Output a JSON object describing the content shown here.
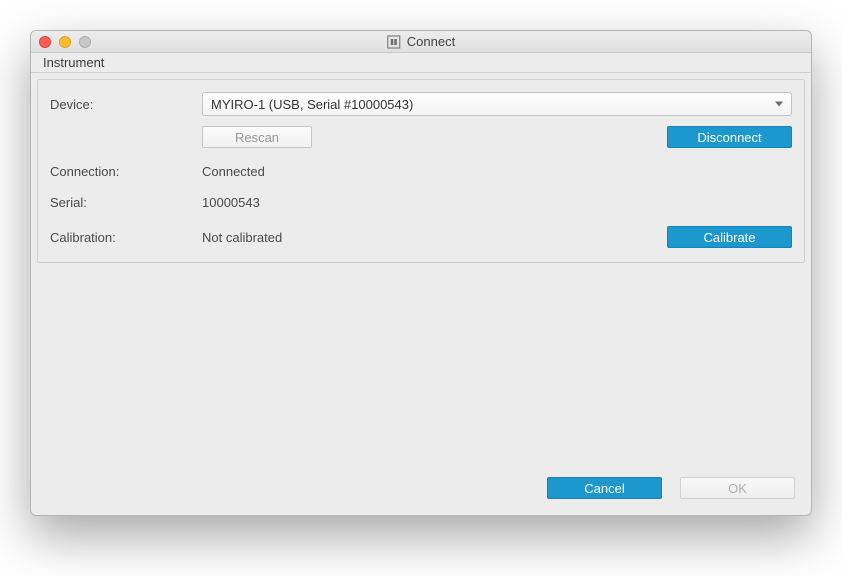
{
  "window": {
    "title": "Connect"
  },
  "menu": {
    "instrument": "Instrument"
  },
  "labels": {
    "device": "Device:",
    "connection": "Connection:",
    "serial": "Serial:",
    "calibration": "Calibration:"
  },
  "device": {
    "selected": "MYIRO-1 (USB, Serial #10000543)"
  },
  "buttons": {
    "rescan": "Rescan",
    "disconnect": "Disconnect",
    "calibrate": "Calibrate",
    "cancel": "Cancel",
    "ok": "OK"
  },
  "status": {
    "connection": "Connected",
    "serial": "10000543",
    "calibration": "Not calibrated"
  }
}
